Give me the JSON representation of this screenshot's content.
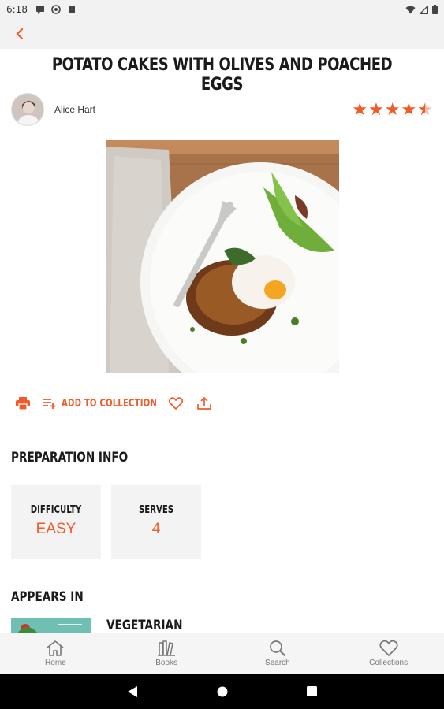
{
  "status_bar": {
    "time": "6:18",
    "icons": [
      "message-icon",
      "sync-icon",
      "sd-card-icon",
      "wifi-icon",
      "signal-icon",
      "battery-icon"
    ]
  },
  "app_bar": {
    "back_icon": "chevron-left-icon"
  },
  "recipe": {
    "title": "POTATO CAKES WITH OLIVES AND POACHED EGGS",
    "author": "Alice Hart",
    "rating": 4.5,
    "rating_max": 5
  },
  "actions": {
    "print_icon": "print-icon",
    "add_to_collection_label": "ADD TO COLLECTION",
    "favorite_icon": "heart-icon",
    "share_icon": "share-icon"
  },
  "preparation": {
    "heading": "PREPARATION INFO",
    "difficulty_label": "DIFFICULTY",
    "difficulty_value": "EASY",
    "serves_label": "SERVES",
    "serves_value": "4"
  },
  "appears_in": {
    "heading": "APPEARS IN",
    "book_title": "VEGETARIAN"
  },
  "bottom_nav": {
    "items": [
      {
        "label": "Home",
        "icon": "home-icon"
      },
      {
        "label": "Books",
        "icon": "books-icon"
      },
      {
        "label": "Search",
        "icon": "search-icon"
      },
      {
        "label": "Collections",
        "icon": "heart-icon"
      }
    ]
  },
  "colors": {
    "accent": "#f25a29",
    "card_bg": "#f3f3f3",
    "bar_bg": "#f2f2f2"
  }
}
